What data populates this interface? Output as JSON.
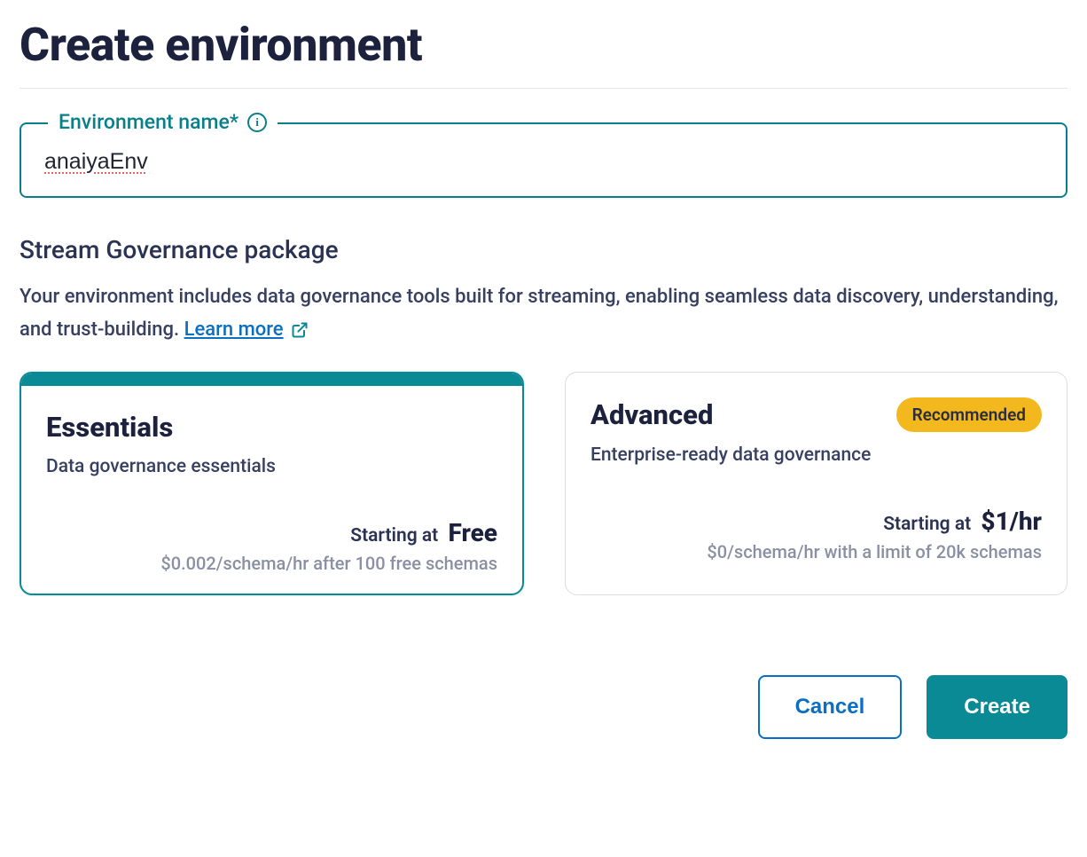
{
  "header": {
    "title": "Create environment"
  },
  "form": {
    "name_label": "Environment name*",
    "name_value": "anaiyaEnv"
  },
  "governance": {
    "section_title": "Stream Governance package",
    "description": "Your environment includes data governance tools built for streaming, enabling seamless data discovery, understanding, and trust-building. ",
    "learn_more": "Learn more"
  },
  "packages": [
    {
      "title": "Essentials",
      "subtitle": "Data governance essentials",
      "starting_prefix": "Starting at",
      "starting_price": "Free",
      "note": "$0.002/schema/hr after 100 free schemas",
      "selected": true,
      "badge": null
    },
    {
      "title": "Advanced",
      "subtitle": "Enterprise-ready data governance",
      "starting_prefix": "Starting at",
      "starting_price": "$1/hr",
      "note": "$0/schema/hr with a limit of 20k schemas",
      "selected": false,
      "badge": "Recommended"
    }
  ],
  "actions": {
    "cancel": "Cancel",
    "create": "Create"
  }
}
